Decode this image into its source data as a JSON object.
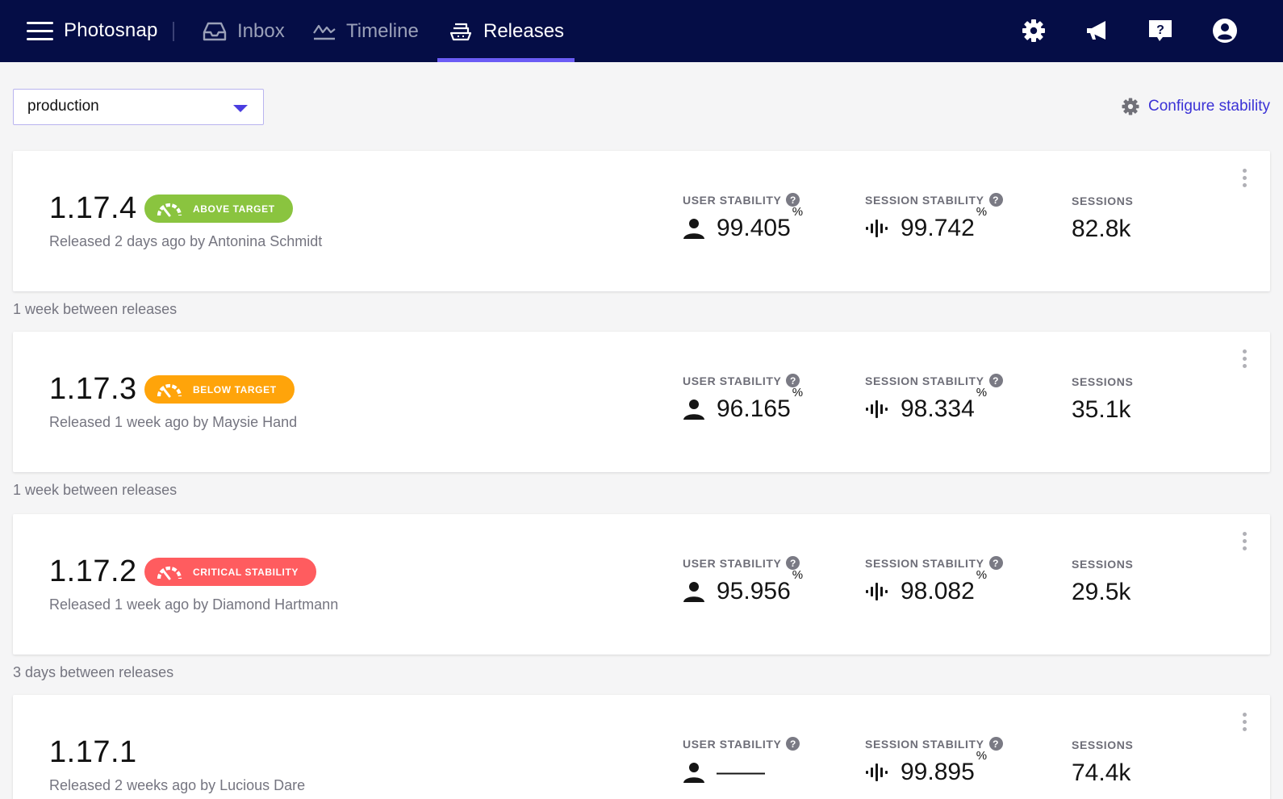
{
  "nav": {
    "brand": "Photosnap",
    "tabs": [
      {
        "label": "Inbox",
        "icon": "inbox-icon"
      },
      {
        "label": "Timeline",
        "icon": "timeline-icon"
      },
      {
        "label": "Releases",
        "icon": "releases-icon",
        "active": true
      }
    ],
    "right_icons": [
      "settings-icon",
      "megaphone-icon",
      "help-icon",
      "user-icon"
    ]
  },
  "filter": {
    "environment": "production",
    "configure_label": "Configure stability"
  },
  "labels": {
    "user_stability": "USER STABILITY",
    "session_stability": "SESSION STABILITY",
    "sessions": "SESSIONS",
    "help_glyph": "?",
    "percent": "%"
  },
  "releases": [
    {
      "version": "1.17.4",
      "badge": "ABOVE TARGET",
      "badge_color": "#8ac43f",
      "released": "Released 2 days ago by Antonina Schmidt",
      "user_stability": "99.405",
      "session_stability": "99.742",
      "sessions": "82.8k"
    },
    {
      "version": "1.17.3",
      "badge": "BELOW TARGET",
      "badge_color": "#ffa40a",
      "released": "Released 1 week ago by Maysie Hand",
      "user_stability": "96.165",
      "session_stability": "98.334",
      "sessions": "35.1k"
    },
    {
      "version": "1.17.2",
      "badge": "CRITICAL STABILITY",
      "badge_color": "#ff5c5f",
      "released": "Released 1 week ago by Diamond Hartmann",
      "user_stability": "95.956",
      "session_stability": "98.082",
      "sessions": "29.5k"
    },
    {
      "version": "1.17.1",
      "badge": "",
      "badge_color": "",
      "released": "Released 2 weeks ago by Lucious Dare",
      "user_stability": "——",
      "session_stability": "99.895",
      "sessions": "74.4k"
    }
  ],
  "between": [
    "1 week between releases",
    "1 week between releases",
    "3 days between releases"
  ]
}
